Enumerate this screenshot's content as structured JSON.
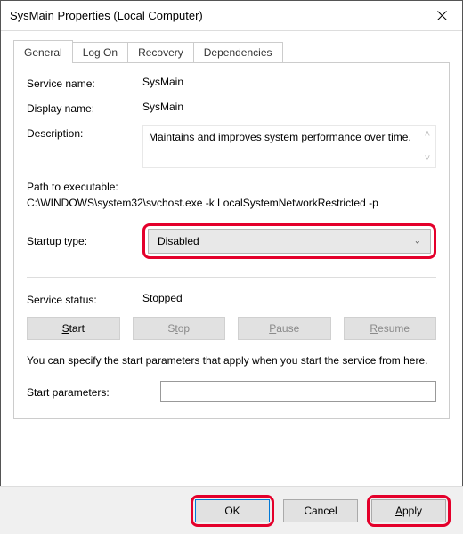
{
  "window": {
    "title": "SysMain Properties (Local Computer)"
  },
  "tabs": {
    "general": "General",
    "logon": "Log On",
    "recovery": "Recovery",
    "dependencies": "Dependencies"
  },
  "labels": {
    "service_name": "Service name:",
    "display_name": "Display name:",
    "description": "Description:",
    "path_header": "Path to executable:",
    "startup_type": "Startup type:",
    "service_status": "Service status:",
    "start_params": "Start parameters:"
  },
  "values": {
    "service_name": "SysMain",
    "display_name": "SysMain",
    "description": "Maintains and improves system performance over time.",
    "path": "C:\\WINDOWS\\system32\\svchost.exe -k LocalSystemNetworkRestricted -p",
    "startup_type": "Disabled",
    "service_status": "Stopped",
    "start_params": ""
  },
  "buttons": {
    "start_pre": "",
    "start_u": "S",
    "start_post": "tart",
    "stop_pre": "S",
    "stop_u": "t",
    "stop_post": "op",
    "pause_pre": "",
    "pause_u": "P",
    "pause_post": "ause",
    "resume_pre": "",
    "resume_u": "R",
    "resume_post": "esume",
    "ok": "OK",
    "cancel": "Cancel",
    "apply_pre": "",
    "apply_u": "A",
    "apply_post": "pply"
  },
  "note": "You can specify the start parameters that apply when you start the service from here."
}
